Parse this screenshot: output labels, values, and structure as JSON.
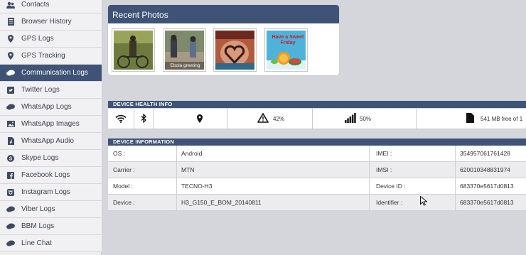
{
  "sidebar": {
    "items": [
      {
        "label": "Contacts",
        "icon": "contacts-icon"
      },
      {
        "label": "Browser History",
        "icon": "browser-history-icon"
      },
      {
        "label": "GPS Logs",
        "icon": "map-pin-icon"
      },
      {
        "label": "GPS Tracking",
        "icon": "map-pin-icon"
      },
      {
        "label": "Communication Logs",
        "icon": "chat-icon"
      },
      {
        "label": "Twitter Logs",
        "icon": "twitter-icon"
      },
      {
        "label": "WhatsApp Logs",
        "icon": "chat-icon"
      },
      {
        "label": "WhatsApp Images",
        "icon": "image-icon"
      },
      {
        "label": "WhatsApp Audio",
        "icon": "audio-icon"
      },
      {
        "label": "Skype Logs",
        "icon": "skype-icon"
      },
      {
        "label": "Facebook Logs",
        "icon": "facebook-icon"
      },
      {
        "label": "Instagram Logs",
        "icon": "instagram-icon"
      },
      {
        "label": "Viber Logs",
        "icon": "chat-icon"
      },
      {
        "label": "BBM Logs",
        "icon": "chat-icon"
      },
      {
        "label": "Line Chat",
        "icon": "chat-icon"
      }
    ],
    "active_index": 4
  },
  "photos": {
    "title": "Recent Photos",
    "items": [
      {
        "caption": ""
      },
      {
        "caption": "Ebola greeting"
      },
      {
        "caption": ""
      },
      {
        "caption": "Have a Sweet Friday"
      }
    ]
  },
  "health": {
    "title": "DEVICE HEALTH INFO",
    "signal_percent": "42%",
    "network_percent": "50%",
    "storage_text": "541 MB free of 1"
  },
  "device": {
    "title": "DEVICE INFORMATION",
    "rows": [
      {
        "label": "OS :",
        "value": "Android",
        "label2": "IMEI :",
        "value2": "354957061761428"
      },
      {
        "label": "Carrier :",
        "value": "MTN",
        "label2": "IMSI :",
        "value2": "620010348831974"
      },
      {
        "label": "Model :",
        "value": "TECNO-H3",
        "label2": "Device ID :",
        "value2": "683370e5617d0813"
      },
      {
        "label": "Device :",
        "value": "H3_G150_E_BOM_20140811",
        "label2": "Identifier :",
        "value2": "683370e5617d0813"
      }
    ]
  },
  "colors": {
    "accent": "#3e5376",
    "sidebar_bg": "#f1f1f4",
    "page_bg": "#d4d6db"
  }
}
